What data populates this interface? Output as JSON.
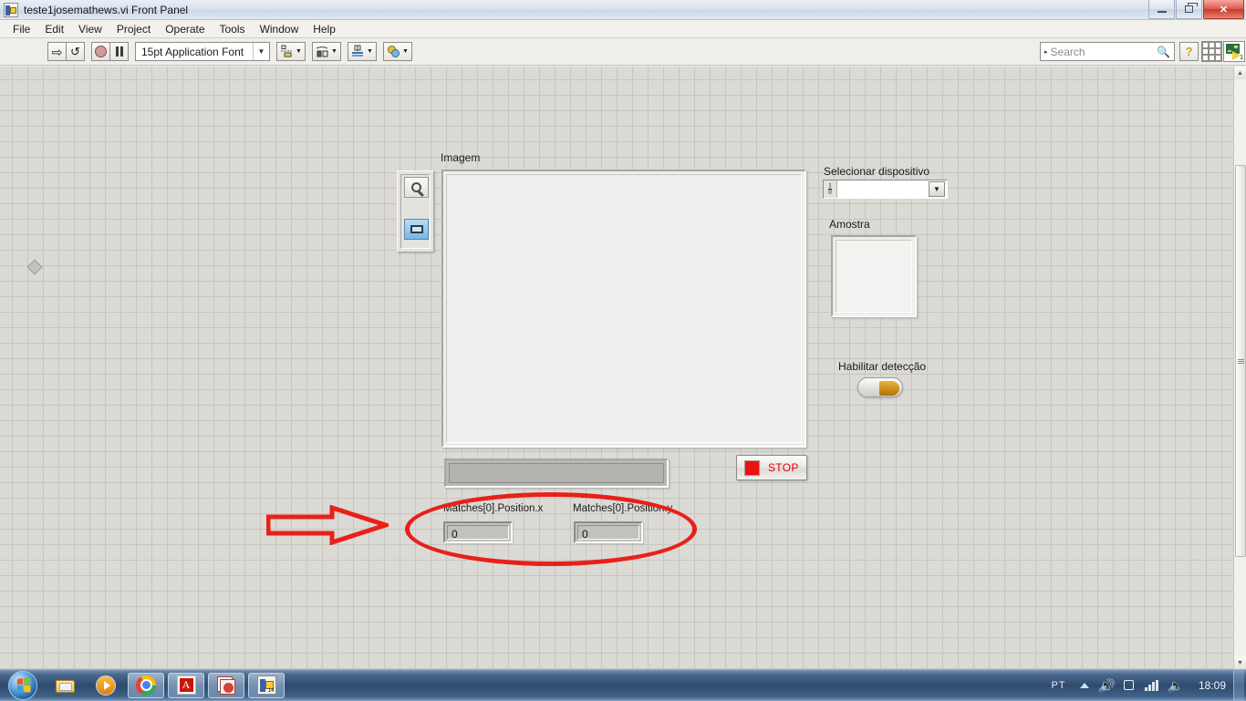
{
  "window": {
    "title": "teste1josemathews.vi Front Panel",
    "icon": "labview-vi-icon",
    "controls": {
      "minimize": "minimize-button",
      "restore": "restore-button",
      "close": "✕"
    }
  },
  "menubar": {
    "items": [
      "File",
      "Edit",
      "View",
      "Project",
      "Operate",
      "Tools",
      "Window",
      "Help"
    ]
  },
  "toolbar": {
    "run_icon": "run-arrow-icon",
    "run_continuous_icon": "run-continuously-icon",
    "abort_icon": "abort-execution-icon",
    "pause_icon": "pause-icon",
    "font_selector": "15pt Application Font",
    "align_icon": "align-objects-icon",
    "distribute_icon": "distribute-objects-icon",
    "resize_icon": "resize-objects-icon",
    "reorder_icon": "reorder-objects-icon",
    "search_placeholder": "Search",
    "search_value": "",
    "search_icon": "magnifier-icon",
    "help_icon": "context-help-icon",
    "grid_icon": "grid-icon",
    "vi_icon": "vi-thumbnail-icon",
    "vi_number": "1"
  },
  "panel": {
    "image_label": "Imagem",
    "tool_palette": {
      "zoom_tool": "magnifier-icon",
      "select_tool": "selection-rectangle-icon",
      "active_tool": "select_tool"
    },
    "device_selector": {
      "label": "Selecionar dispositivo",
      "value": "",
      "glyph": "io-glyph",
      "dropdown_icon": "chevron-down-icon"
    },
    "sample": {
      "label": "Amostra"
    },
    "enable_detection": {
      "label": "Habilitar detecção",
      "state": "off",
      "knob_color": "#c88c18"
    },
    "stop_button": {
      "label": "STOP",
      "led_color": "#ee1111",
      "text_color": "#dd0000"
    },
    "string_bar": {
      "value": ""
    },
    "indicators": [
      {
        "label": "Matches[0].Position.x",
        "value": "0"
      },
      {
        "label": "Matches[0].Position.y",
        "value": "0"
      }
    ],
    "annotations": {
      "ellipse_color": "#e8201a",
      "arrow_color": "#e8201a",
      "arrow_direction": "right"
    }
  },
  "scrollbar": {
    "up_arrow": "▲",
    "down_arrow": "▼"
  },
  "taskbar": {
    "start": "start-orb",
    "tasks": [
      {
        "name": "windows-explorer",
        "state": "pinned"
      },
      {
        "name": "windows-media-player",
        "state": "pinned"
      },
      {
        "name": "google-chrome",
        "state": "open"
      },
      {
        "name": "adobe-reader",
        "state": "open"
      },
      {
        "name": "photo-viewer",
        "state": "open"
      },
      {
        "name": "labview",
        "state": "open"
      }
    ],
    "tray": {
      "language": "PT",
      "show_hidden_icon": "chevron-up-icon",
      "volume_icon": "speaker-red-icon",
      "network_icon": "network-icon",
      "signal_icon": "signal-bars-icon",
      "speaker_icon": "speaker-icon",
      "clock": "18:09"
    }
  }
}
